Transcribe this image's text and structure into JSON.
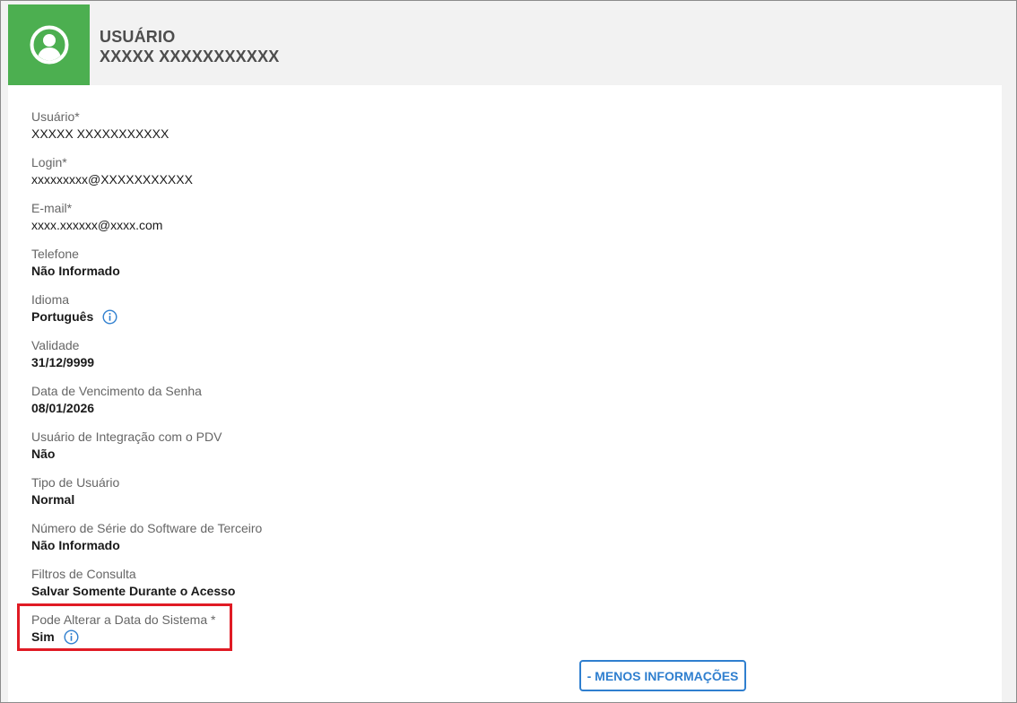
{
  "header": {
    "title": "USUÁRIO",
    "subtitle": "XXXXX XXXXXXXXXXX"
  },
  "fields": [
    {
      "label": "Usuário*",
      "value": "XXXXX XXXXXXXXXXX"
    },
    {
      "label": "Login*",
      "value": "xxxxxxxxx@XXXXXXXXXXX"
    },
    {
      "label": "E-mail*",
      "value": "xxxx.xxxxxx@xxxx.com"
    },
    {
      "label": "Telefone",
      "value": "Não Informado"
    },
    {
      "label": "Idioma",
      "value": "Português",
      "icon": "info-icon"
    },
    {
      "label": "Validade",
      "value": "31/12/9999"
    },
    {
      "label": "Data de Vencimento da Senha",
      "value": "08/01/2026"
    },
    {
      "label": "Usuário de Integração com o PDV",
      "value": "Não"
    },
    {
      "label": "Tipo de Usuário",
      "value": "Normal"
    },
    {
      "label": "Número de Série do Software de Terceiro",
      "value": "Não Informado"
    },
    {
      "label": "Filtros de Consulta",
      "value": "Salvar Somente Durante o Acesso"
    },
    {
      "label": "Pode Alterar a Data do Sistema *",
      "value": "Sim",
      "icon": "info-icon"
    }
  ],
  "actions": {
    "less_info_label": "- MENOS INFORMAÇÕES"
  },
  "colors": {
    "accent_green": "#4caf50",
    "link_blue": "#2f7fcf",
    "highlight_red": "#e01b24"
  }
}
